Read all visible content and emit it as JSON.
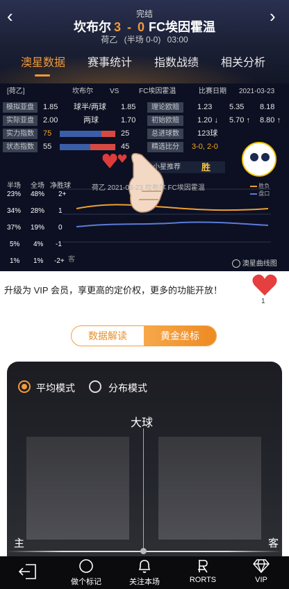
{
  "header": {
    "status": "完结",
    "home_team": "坎布尔",
    "score": "3 - 0",
    "away_team": "FC埃因霍温",
    "league": "荷乙",
    "half_score": "(半场 0-0)",
    "time": "03:00"
  },
  "tabs": [
    {
      "label": "澳星数据",
      "active": true
    },
    {
      "label": "赛事统计"
    },
    {
      "label": "指数战绩"
    },
    {
      "label": "相关分析"
    }
  ],
  "stats": {
    "league_tag": "[荷乙]",
    "home": "坎布尔",
    "vs": "VS",
    "away": "FC埃因霍温",
    "date_label": "比赛日期",
    "date": "2021-03-23",
    "rows": [
      {
        "label": "模拟亚盘",
        "home": "1.85",
        "mid": "球半/两球",
        "away": "1.85",
        "label2": "理论欧赔",
        "v1": "1.23",
        "v2": "5.35",
        "v3": "8.18"
      },
      {
        "label": "实际亚盘",
        "home": "2.00",
        "mid": "两球",
        "away": "1.70",
        "label2": "初始欧赔",
        "v1": "1.20 ↓",
        "v2": "5.70 ↑",
        "v3": "8.80 ↑"
      },
      {
        "label": "实力指数",
        "home": "75",
        "away": "25",
        "label2": "总进球数",
        "v1": "123球"
      },
      {
        "label": "状态指数",
        "home": "55",
        "away": "45",
        "label2": "精选比分",
        "v1": "3-0, 2-0"
      }
    ],
    "rec_label": "小星推荐",
    "rec_value": "胜"
  },
  "probability": {
    "headers": [
      "半场",
      "全场",
      "净胜球"
    ],
    "rows": [
      [
        "23%",
        "48%",
        "2+"
      ],
      [
        "34%",
        "28%",
        "1"
      ],
      [
        "37%",
        "19%",
        "0"
      ],
      [
        "5%",
        "4%",
        "-1"
      ],
      [
        "1%",
        "1%",
        "-2+"
      ]
    ],
    "curve_title": "荷乙 2021-03-23 坎布尔 FC埃因霍温",
    "legend_1": "胜负",
    "legend_2": "盘口",
    "watermark": "澳星曲线图",
    "side": "客"
  },
  "vip": {
    "text": "升级为 VIP 会员，享更高的定价权，更多的功能开放！",
    "likes": "1"
  },
  "segment": {
    "left": "数据解读",
    "right": "黄金坐标"
  },
  "modes": {
    "avg": "平均模式",
    "dist": "分布模式"
  },
  "plot": {
    "top": "大球",
    "left": "主",
    "right": "客"
  },
  "bottom_nav": [
    {
      "label": "",
      "icon": "logout-icon"
    },
    {
      "label": "做个标记",
      "icon": "circle-icon"
    },
    {
      "label": "关注本场",
      "icon": "bell-icon"
    },
    {
      "label": "RORTS",
      "icon": "rorts-icon"
    },
    {
      "label": "VIP",
      "icon": "diamond-icon"
    }
  ]
}
